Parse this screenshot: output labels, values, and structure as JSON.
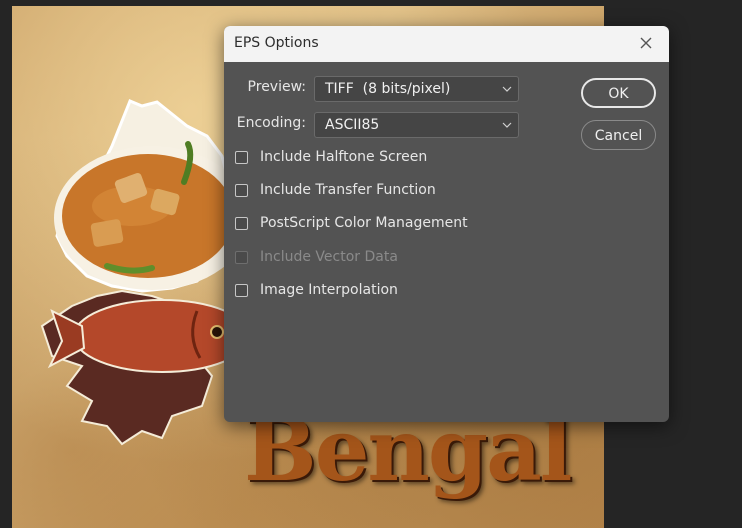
{
  "dialog": {
    "title": "EPS Options",
    "preview": {
      "label": "Preview:",
      "value": "TIFF  (8 bits/pixel)"
    },
    "encoding": {
      "label": "Encoding:",
      "value": "ASCII85"
    },
    "options": [
      {
        "label": "Include Halftone Screen",
        "checked": false,
        "enabled": true
      },
      {
        "label": "Include Transfer Function",
        "checked": false,
        "enabled": true
      },
      {
        "label": "PostScript Color Management",
        "checked": false,
        "enabled": true
      },
      {
        "label": "Include Vector Data",
        "checked": false,
        "enabled": false
      },
      {
        "label": "Image Interpolation",
        "checked": false,
        "enabled": true
      }
    ],
    "ok_label": "OK",
    "cancel_label": "Cancel"
  },
  "canvas": {
    "headline": "Bengal"
  },
  "colors": {
    "dialog_bg": "#535353",
    "title_bar_bg": "#f3f3f3",
    "headline": "#a4551a"
  }
}
